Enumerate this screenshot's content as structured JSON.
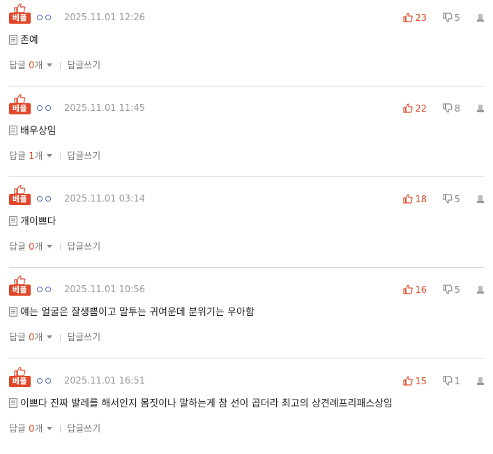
{
  "colors": {
    "accent": "#e1472a",
    "author_blue": "#4a67b8",
    "muted": "#9a9a9a",
    "divider": "#d6d6d6"
  },
  "icons": {
    "best": "thumbs-up-icon",
    "upvote": "thumbs-up-icon",
    "downvote": "thumbs-down-icon",
    "report": "report-icon",
    "comment": "document-icon",
    "dropdown": "caret-down-icon"
  },
  "comments": [
    {
      "badge": "베플",
      "author": "ㅇㅇ",
      "timestamp": "2025.11.01 12:26",
      "upvotes": "23",
      "downvotes": "5",
      "text": "존예",
      "reply_label": "답글",
      "reply_count": "0",
      "reply_unit": "개",
      "write_reply": "답글쓰기"
    },
    {
      "badge": "베플",
      "author": "ㅇㅇ",
      "timestamp": "2025.11.01 11:45",
      "upvotes": "22",
      "downvotes": "8",
      "text": "배우상임",
      "reply_label": "답글",
      "reply_count": "1",
      "reply_unit": "개",
      "write_reply": "답글쓰기"
    },
    {
      "badge": "베플",
      "author": "ㅇㅇ",
      "timestamp": "2025.11.01 03:14",
      "upvotes": "18",
      "downvotes": "5",
      "text": "개이쁘다",
      "reply_label": "답글",
      "reply_count": "0",
      "reply_unit": "개",
      "write_reply": "답글쓰기"
    },
    {
      "badge": "베플",
      "author": "ㅇㅇ",
      "timestamp": "2025.11.01 10:56",
      "upvotes": "16",
      "downvotes": "5",
      "text": "얘는 얼굴은 잘생쁨이고 말투는 귀여운데 분위기는 우아함",
      "reply_label": "답글",
      "reply_count": "0",
      "reply_unit": "개",
      "write_reply": "답글쓰기"
    },
    {
      "badge": "베플",
      "author": "ㅇㅇ",
      "timestamp": "2025.11.01 16:51",
      "upvotes": "15",
      "downvotes": "1",
      "text": "이쁘다 진짜 발레를 해서인지 몸짓이나 말하는게 참 선이 곱더라 최고의 상견례프리패스상임",
      "reply_label": "답글",
      "reply_count": "0",
      "reply_unit": "개",
      "write_reply": "답글쓰기"
    }
  ]
}
